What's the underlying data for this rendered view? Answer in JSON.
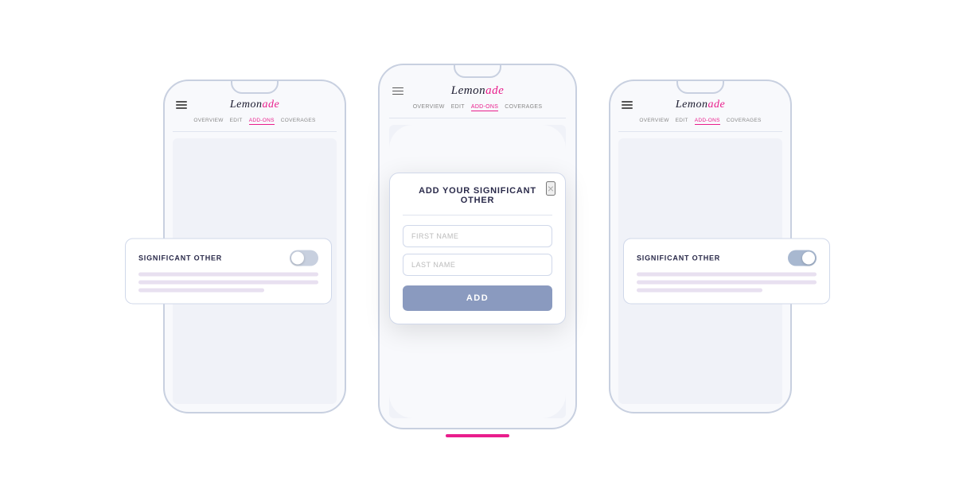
{
  "app": {
    "logo": "Lemonade",
    "nav_items": [
      "OVERVIEW",
      "EDIT",
      "ADD-ONS",
      "COVERAGES"
    ],
    "active_nav": "ADD-ONS"
  },
  "phones": [
    {
      "id": "left",
      "card": {
        "title": "SIGNIFICANT OTHER",
        "toggle_active": false
      }
    },
    {
      "id": "center",
      "modal": {
        "title": "ADD YOUR SIGNIFICANT OTHER",
        "first_name_placeholder": "FIRST NAME",
        "last_name_placeholder": "LAST NAME",
        "add_button_label": "ADD",
        "close_icon": "×"
      }
    },
    {
      "id": "right",
      "card": {
        "title": "SIGNIFICANT OTHER",
        "toggle_active": true
      }
    }
  ],
  "bottom_indicator": true
}
